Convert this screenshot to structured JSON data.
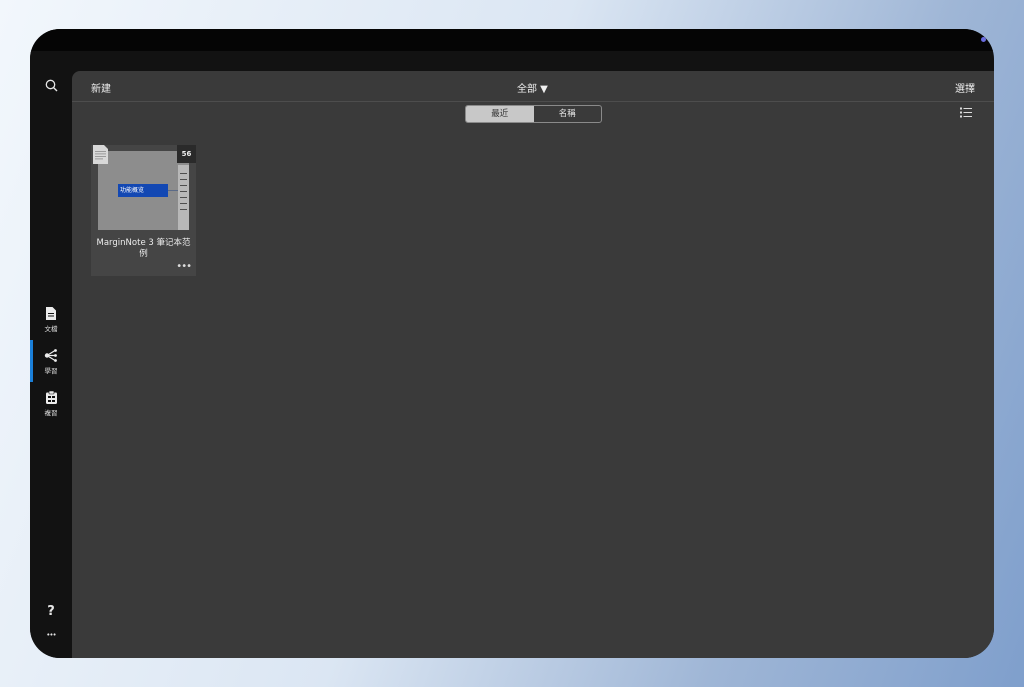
{
  "topbar": {
    "new_label": "新建",
    "filter_label": "全部 ▼",
    "select_label": "選擇"
  },
  "sort": {
    "options": [
      "最近",
      "名稱"
    ],
    "selected": "最近"
  },
  "sidebar": {
    "items": [
      {
        "label": "文檔",
        "icon": "document-icon",
        "active": false
      },
      {
        "label": "學習",
        "icon": "mindmap-icon",
        "active": true
      },
      {
        "label": "複習",
        "icon": "review-icon",
        "active": false
      }
    ],
    "help_label": "?",
    "more_label": "•••"
  },
  "notebooks": [
    {
      "title": "MarginNote 3 筆记本范例",
      "count": "56",
      "preview_node": "功能概览",
      "more_label": "•••"
    }
  ],
  "colors": {
    "accent": "#1a7fd8",
    "panel": "#3a3a3a",
    "sidebar": "#121212",
    "node": "#1348b3"
  }
}
